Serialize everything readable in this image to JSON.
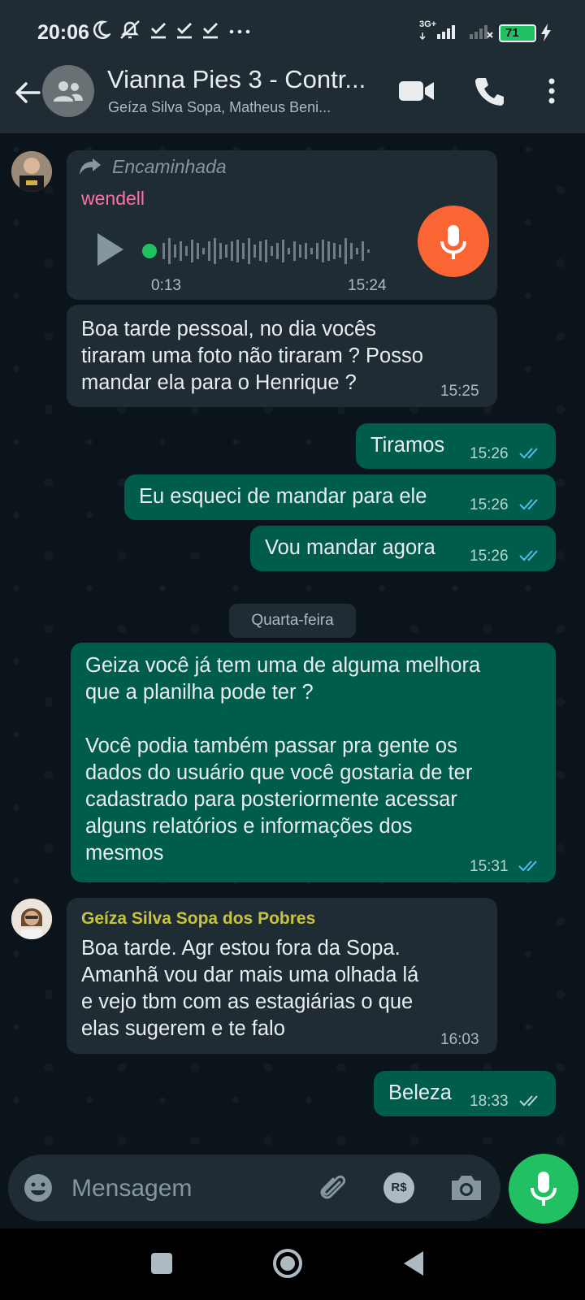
{
  "status_bar": {
    "time": "20:06",
    "network": "3G+",
    "battery": "71"
  },
  "header": {
    "title": "Vianna Pies 3 - Contr...",
    "subtitle": "Geíza Silva Sopa, Matheus Beni..."
  },
  "messages": [
    {
      "type": "voice",
      "direction": "in",
      "forwarded_label": "Encaminhada",
      "sender": "wendell",
      "duration": "0:13",
      "time": "15:24"
    },
    {
      "type": "text",
      "direction": "in",
      "text": "Boa tarde pessoal, no dia vocês\ntiraram uma foto não tiraram ? Posso\nmandar ela para o Henrique ?",
      "time": "15:25"
    },
    {
      "type": "text",
      "direction": "out",
      "text": "Tiramos",
      "time": "15:26"
    },
    {
      "type": "text",
      "direction": "out",
      "text": "Eu esqueci de mandar para ele",
      "time": "15:26"
    },
    {
      "type": "text",
      "direction": "out",
      "text": "Vou mandar agora",
      "time": "15:26"
    },
    {
      "type": "text",
      "direction": "out",
      "text": "Geiza você já tem uma de alguma melhora\nque a planilha pode ter ?\n\nVocê podia também passar pra gente os\ndados do usuário que você gostaria de ter\ncadastrado para posteriormente acessar\nalguns relatórios e informações dos\nmesmos",
      "time": "15:31"
    },
    {
      "type": "text",
      "direction": "in",
      "sender": "Geíza Silva Sopa dos Pobres",
      "text": "Boa tarde. Agr estou fora da Sopa.\nAmanhã vou dar mais uma olhada lá\ne vejo tbm com as estagiárias o que\nelas sugerem e te falo",
      "time": "16:03"
    },
    {
      "type": "text",
      "direction": "out",
      "text": "Beleza",
      "time": "18:33"
    }
  ],
  "day_separator": "Quarta-feira",
  "input": {
    "placeholder": "Mensagem",
    "pay_label": "R$"
  },
  "colors": {
    "incoming_bubble": "#1f2c34",
    "outgoing_bubble": "#005c4b",
    "accent_green": "#21c063",
    "sender_wendell": "#ff72a1",
    "sender_geiza": "#c6c43f",
    "voice_mic": "#fa6533",
    "read_ticks": "#53bdeb"
  }
}
